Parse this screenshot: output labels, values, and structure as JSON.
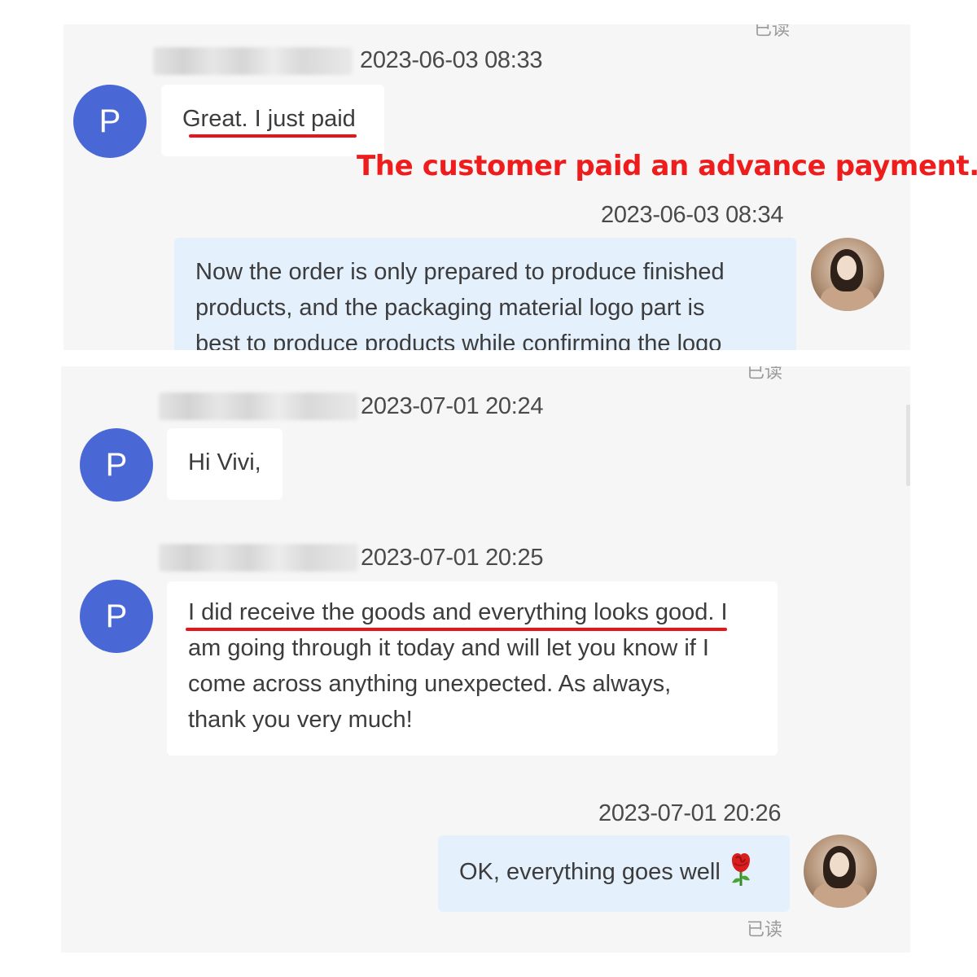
{
  "annotation": {
    "text": "The customer paid an advance payment.",
    "color": "#ee1c1c"
  },
  "panel1": {
    "read_status": "已读",
    "messages": [
      {
        "side": "left",
        "avatar_letter": "P",
        "timestamp": "2023-06-03 08:33",
        "text": "Great. I just paid"
      },
      {
        "side": "right",
        "timestamp": "2023-06-03 08:34",
        "lines": [
          "Now the order is only prepared to produce finished",
          "products, and the packaging material logo part is",
          "best to produce products while confirming the logo"
        ]
      }
    ]
  },
  "panel2": {
    "read_status_top": "已读",
    "read_status_bottom": "已读",
    "messages": [
      {
        "side": "left",
        "avatar_letter": "P",
        "timestamp": "2023-07-01 20:24",
        "text": "Hi Vivi,"
      },
      {
        "side": "left",
        "avatar_letter": "P",
        "timestamp": "2023-07-01 20:25",
        "lines": [
          "I did receive the goods and everything looks good. I",
          "am going through it today and will let you know if I",
          "come across anything unexpected. As always,",
          "thank you very much!"
        ]
      },
      {
        "side": "right",
        "timestamp": "2023-07-01 20:26",
        "text": "OK, everything goes well",
        "emoji": "rose-icon"
      }
    ]
  },
  "colors": {
    "avatar_blue": "#4a67d6",
    "outgoing_bubble": "#e5f0fd",
    "incoming_bubble": "#ffffff",
    "panel_bg": "#f6f6f6",
    "underline_red": "#e8141a"
  }
}
